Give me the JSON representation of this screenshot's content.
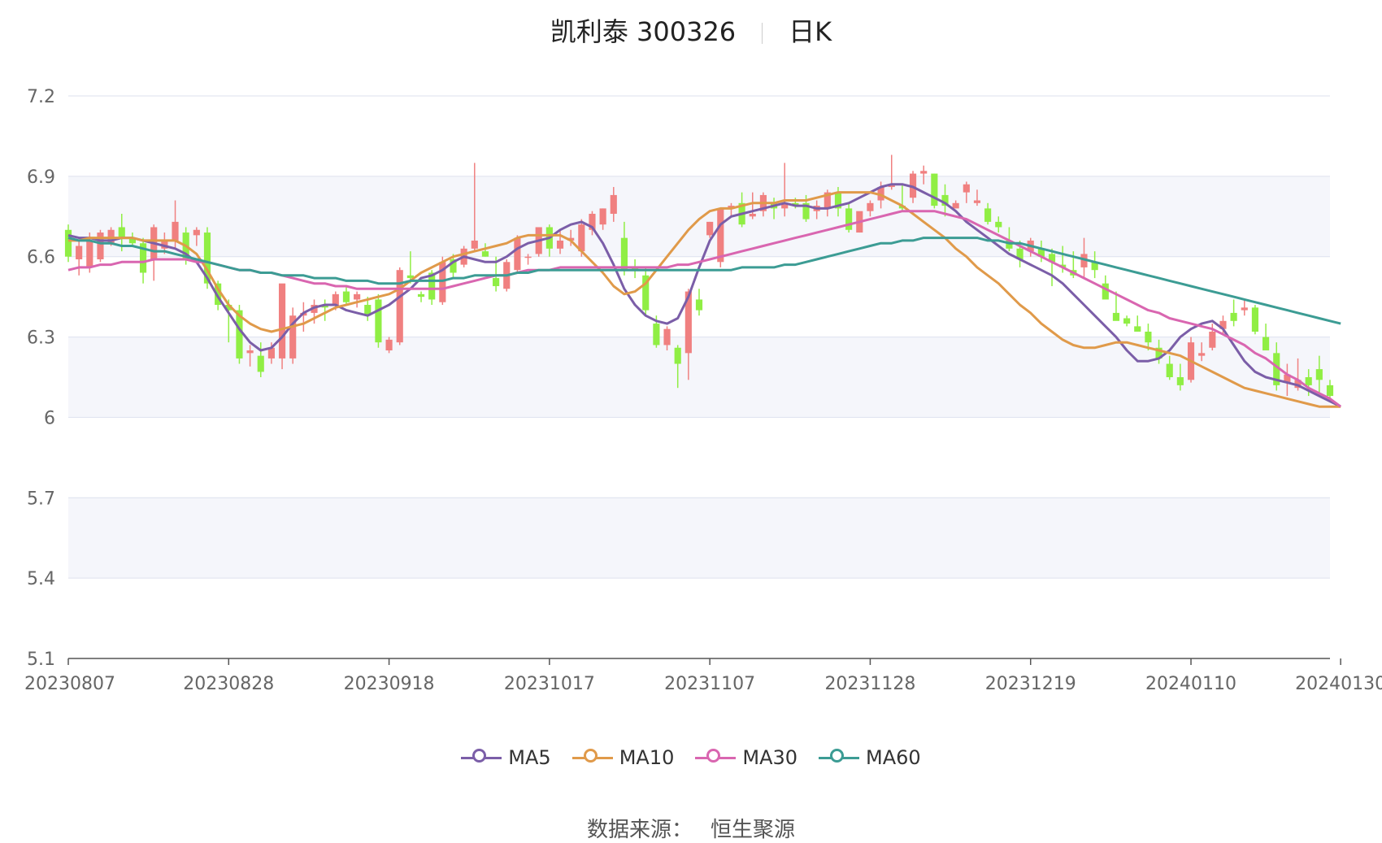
{
  "header": {
    "stock": "凯利泰 300326",
    "period": "日K"
  },
  "source": {
    "label": "数据来源：",
    "value": "恒生聚源"
  },
  "chart_data": {
    "type": "candlestick",
    "title": "凯利泰 300326",
    "period": "日K",
    "ylim": [
      5.1,
      7.2
    ],
    "yticks": [
      "7.2",
      "6.9",
      "6.6",
      "6.3",
      "6",
      "5.7",
      "5.4",
      "5.1"
    ],
    "xticks": [
      {
        "i": 0,
        "label": "20230807"
      },
      {
        "i": 15,
        "label": "20230828"
      },
      {
        "i": 30,
        "label": "20230918"
      },
      {
        "i": 45,
        "label": "20231017"
      },
      {
        "i": 60,
        "label": "20231107"
      },
      {
        "i": 75,
        "label": "20231128"
      },
      {
        "i": 90,
        "label": "20231219"
      },
      {
        "i": 105,
        "label": "20240110"
      },
      {
        "i": 119,
        "label": "20240130"
      }
    ],
    "up_color": "#f08080",
    "down_color": "#90ee44",
    "ohlc": [
      [
        6.7,
        6.72,
        6.58,
        6.6
      ],
      [
        6.59,
        6.66,
        6.53,
        6.64
      ],
      [
        6.56,
        6.69,
        6.54,
        6.66
      ],
      [
        6.59,
        6.7,
        6.58,
        6.69
      ],
      [
        6.65,
        6.71,
        6.64,
        6.7
      ],
      [
        6.71,
        6.76,
        6.62,
        6.67
      ],
      [
        6.67,
        6.69,
        6.64,
        6.65
      ],
      [
        6.65,
        6.67,
        6.5,
        6.54
      ],
      [
        6.59,
        6.72,
        6.51,
        6.71
      ],
      [
        6.63,
        6.69,
        6.61,
        6.66
      ],
      [
        6.66,
        6.81,
        6.63,
        6.73
      ],
      [
        6.69,
        6.71,
        6.57,
        6.59
      ],
      [
        6.68,
        6.71,
        6.64,
        6.7
      ],
      [
        6.69,
        6.71,
        6.48,
        6.5
      ],
      [
        6.5,
        6.51,
        6.4,
        6.42
      ],
      [
        6.42,
        6.44,
        6.28,
        6.4
      ],
      [
        6.4,
        6.42,
        6.2,
        6.22
      ],
      [
        6.24,
        6.27,
        6.19,
        6.25
      ],
      [
        6.23,
        6.28,
        6.15,
        6.17
      ],
      [
        6.22,
        6.28,
        6.2,
        6.26
      ],
      [
        6.22,
        6.26,
        6.18,
        6.5
      ],
      [
        6.22,
        6.41,
        6.2,
        6.38
      ],
      [
        6.38,
        6.43,
        6.32,
        6.39
      ],
      [
        6.39,
        6.44,
        6.35,
        6.42
      ],
      [
        6.42,
        6.44,
        6.36,
        6.41
      ],
      [
        6.42,
        6.47,
        6.4,
        6.46
      ],
      [
        6.47,
        6.49,
        6.42,
        6.43
      ],
      [
        6.44,
        6.47,
        6.41,
        6.46
      ],
      [
        6.42,
        6.45,
        6.36,
        6.38
      ],
      [
        6.44,
        6.46,
        6.26,
        6.28
      ],
      [
        6.25,
        6.3,
        6.24,
        6.29
      ],
      [
        6.28,
        6.56,
        6.27,
        6.55
      ],
      [
        6.53,
        6.62,
        6.5,
        6.52
      ],
      [
        6.46,
        6.47,
        6.43,
        6.45
      ],
      [
        6.54,
        6.55,
        6.42,
        6.44
      ],
      [
        6.43,
        6.6,
        6.42,
        6.58
      ],
      [
        6.59,
        6.61,
        6.52,
        6.54
      ],
      [
        6.57,
        6.64,
        6.56,
        6.63
      ],
      [
        6.63,
        6.95,
        6.62,
        6.66
      ],
      [
        6.62,
        6.65,
        6.6,
        6.6
      ],
      [
        6.52,
        6.6,
        6.47,
        6.49
      ],
      [
        6.48,
        6.59,
        6.47,
        6.58
      ],
      [
        6.55,
        6.68,
        6.54,
        6.67
      ],
      [
        6.6,
        6.61,
        6.57,
        6.6
      ],
      [
        6.61,
        6.7,
        6.6,
        6.71
      ],
      [
        6.71,
        6.72,
        6.6,
        6.63
      ],
      [
        6.63,
        6.7,
        6.61,
        6.66
      ],
      [
        6.66,
        6.7,
        6.64,
        6.67
      ],
      [
        6.62,
        6.74,
        6.6,
        6.72
      ],
      [
        6.7,
        6.77,
        6.68,
        6.76
      ],
      [
        6.72,
        6.78,
        6.7,
        6.78
      ],
      [
        6.76,
        6.86,
        6.73,
        6.83
      ],
      [
        6.67,
        6.73,
        6.53,
        6.55
      ],
      [
        6.56,
        6.59,
        6.52,
        6.55
      ],
      [
        6.53,
        6.56,
        6.38,
        6.4
      ],
      [
        6.35,
        6.38,
        6.26,
        6.27
      ],
      [
        6.27,
        6.34,
        6.25,
        6.33
      ],
      [
        6.26,
        6.27,
        6.11,
        6.2
      ],
      [
        6.24,
        6.48,
        6.14,
        6.47
      ],
      [
        6.44,
        6.48,
        6.38,
        6.4
      ],
      [
        6.68,
        6.73,
        6.67,
        6.73
      ],
      [
        6.58,
        6.78,
        6.56,
        6.78
      ],
      [
        6.78,
        6.8,
        6.75,
        6.79
      ],
      [
        6.8,
        6.84,
        6.71,
        6.72
      ],
      [
        6.75,
        6.84,
        6.74,
        6.76
      ],
      [
        6.77,
        6.84,
        6.75,
        6.83
      ],
      [
        6.8,
        6.82,
        6.74,
        6.78
      ],
      [
        6.78,
        6.95,
        6.75,
        6.8
      ],
      [
        6.8,
        6.82,
        6.78,
        6.79
      ],
      [
        6.8,
        6.83,
        6.73,
        6.74
      ],
      [
        6.77,
        6.81,
        6.74,
        6.79
      ],
      [
        6.78,
        6.85,
        6.75,
        6.84
      ],
      [
        6.84,
        6.86,
        6.75,
        6.78
      ],
      [
        6.78,
        6.8,
        6.69,
        6.7
      ],
      [
        6.69,
        6.7,
        6.69,
        6.77
      ],
      [
        6.77,
        6.81,
        6.75,
        6.8
      ],
      [
        6.81,
        6.88,
        6.78,
        6.86
      ],
      [
        6.86,
        6.98,
        6.85,
        6.87
      ],
      [
        6.79,
        6.87,
        6.77,
        6.78
      ],
      [
        6.82,
        6.92,
        6.8,
        6.91
      ],
      [
        6.91,
        6.94,
        6.87,
        6.92
      ],
      [
        6.91,
        6.91,
        6.78,
        6.79
      ],
      [
        6.83,
        6.87,
        6.75,
        6.79
      ],
      [
        6.78,
        6.81,
        6.78,
        6.8
      ],
      [
        6.84,
        6.88,
        6.8,
        6.87
      ],
      [
        6.8,
        6.85,
        6.79,
        6.81
      ],
      [
        6.78,
        6.8,
        6.72,
        6.73
      ],
      [
        6.73,
        6.75,
        6.69,
        6.71
      ],
      [
        6.66,
        6.71,
        6.62,
        6.63
      ],
      [
        6.63,
        6.66,
        6.56,
        6.59
      ],
      [
        6.62,
        6.67,
        6.6,
        6.66
      ],
      [
        6.63,
        6.66,
        6.58,
        6.6
      ],
      [
        6.61,
        6.63,
        6.49,
        6.58
      ],
      [
        6.57,
        6.64,
        6.54,
        6.56
      ],
      [
        6.55,
        6.62,
        6.52,
        6.53
      ],
      [
        6.56,
        6.67,
        6.52,
        6.61
      ],
      [
        6.58,
        6.62,
        6.52,
        6.55
      ],
      [
        6.5,
        6.53,
        6.48,
        6.44
      ],
      [
        6.39,
        6.47,
        6.37,
        6.36
      ],
      [
        6.37,
        6.38,
        6.34,
        6.35
      ],
      [
        6.34,
        6.38,
        6.32,
        6.32
      ],
      [
        6.32,
        6.35,
        6.25,
        6.28
      ],
      [
        6.26,
        6.29,
        6.2,
        6.22
      ],
      [
        6.2,
        6.23,
        6.14,
        6.15
      ],
      [
        6.15,
        6.2,
        6.1,
        6.12
      ],
      [
        6.14,
        6.3,
        6.13,
        6.28
      ],
      [
        6.23,
        6.28,
        6.21,
        6.24
      ],
      [
        6.26,
        6.35,
        6.25,
        6.32
      ],
      [
        6.33,
        6.38,
        6.31,
        6.36
      ],
      [
        6.39,
        6.44,
        6.34,
        6.36
      ],
      [
        6.4,
        6.44,
        6.38,
        6.41
      ],
      [
        6.41,
        6.42,
        6.31,
        6.32
      ],
      [
        6.3,
        6.35,
        6.26,
        6.25
      ],
      [
        6.24,
        6.28,
        6.1,
        6.12
      ],
      [
        6.13,
        6.2,
        6.08,
        6.16
      ],
      [
        6.11,
        6.22,
        6.1,
        6.14
      ],
      [
        6.15,
        6.18,
        6.08,
        6.12
      ],
      [
        6.18,
        6.23,
        6.08,
        6.14
      ],
      [
        6.12,
        6.14,
        6.07,
        6.08
      ]
    ]
  },
  "moving_averages": [
    {
      "name": "MA5",
      "color": "#7b5ea8",
      "values": [
        6.68,
        6.67,
        6.67,
        6.66,
        6.66,
        6.67,
        6.67,
        6.66,
        6.65,
        6.64,
        6.63,
        6.61,
        6.58,
        6.52,
        6.45,
        6.39,
        6.33,
        6.28,
        6.25,
        6.26,
        6.3,
        6.35,
        6.39,
        6.41,
        6.42,
        6.42,
        6.4,
        6.39,
        6.38,
        6.4,
        6.42,
        6.45,
        6.48,
        6.52,
        6.53,
        6.55,
        6.58,
        6.6,
        6.59,
        6.58,
        6.58,
        6.6,
        6.63,
        6.65,
        6.66,
        6.67,
        6.7,
        6.72,
        6.73,
        6.71,
        6.65,
        6.57,
        6.48,
        6.42,
        6.38,
        6.36,
        6.35,
        6.37,
        6.45,
        6.56,
        6.66,
        6.72,
        6.75,
        6.76,
        6.77,
        6.78,
        6.79,
        6.8,
        6.79,
        6.79,
        6.78,
        6.78,
        6.79,
        6.8,
        6.82,
        6.84,
        6.86,
        6.87,
        6.87,
        6.86,
        6.84,
        6.82,
        6.8,
        6.77,
        6.73,
        6.7,
        6.67,
        6.64,
        6.61,
        6.59,
        6.57,
        6.55,
        6.53,
        6.5,
        6.46,
        6.42,
        6.38,
        6.34,
        6.3,
        6.25,
        6.21,
        6.21,
        6.22,
        6.25,
        6.3,
        6.33,
        6.35,
        6.36,
        6.33,
        6.27,
        6.21,
        6.17,
        6.15,
        6.14,
        6.13,
        6.12,
        6.1,
        6.08,
        6.06,
        6.04
      ]
    },
    {
      "name": "MA10",
      "color": "#e09a4a",
      "values": [
        6.66,
        6.66,
        6.67,
        6.67,
        6.67,
        6.67,
        6.67,
        6.66,
        6.66,
        6.66,
        6.66,
        6.64,
        6.61,
        6.55,
        6.48,
        6.42,
        6.38,
        6.35,
        6.33,
        6.32,
        6.33,
        6.34,
        6.35,
        6.37,
        6.39,
        6.41,
        6.42,
        6.43,
        6.44,
        6.45,
        6.46,
        6.48,
        6.51,
        6.54,
        6.56,
        6.58,
        6.6,
        6.61,
        6.62,
        6.63,
        6.64,
        6.65,
        6.67,
        6.68,
        6.68,
        6.68,
        6.68,
        6.66,
        6.62,
        6.58,
        6.54,
        6.49,
        6.46,
        6.47,
        6.5,
        6.55,
        6.6,
        6.65,
        6.7,
        6.74,
        6.77,
        6.78,
        6.78,
        6.79,
        6.8,
        6.8,
        6.8,
        6.81,
        6.81,
        6.81,
        6.82,
        6.83,
        6.84,
        6.84,
        6.84,
        6.84,
        6.83,
        6.81,
        6.79,
        6.76,
        6.73,
        6.7,
        6.67,
        6.63,
        6.6,
        6.56,
        6.53,
        6.5,
        6.46,
        6.42,
        6.39,
        6.35,
        6.32,
        6.29,
        6.27,
        6.26,
        6.26,
        6.27,
        6.28,
        6.28,
        6.27,
        6.26,
        6.25,
        6.24,
        6.23,
        6.21,
        6.19,
        6.17,
        6.15,
        6.13,
        6.11,
        6.1,
        6.09,
        6.08,
        6.07,
        6.06,
        6.05,
        6.04,
        6.04,
        6.04
      ]
    },
    {
      "name": "MA30",
      "color": "#d966b0",
      "values": [
        6.55,
        6.56,
        6.56,
        6.57,
        6.57,
        6.58,
        6.58,
        6.58,
        6.59,
        6.59,
        6.59,
        6.59,
        6.58,
        6.58,
        6.57,
        6.56,
        6.55,
        6.55,
        6.54,
        6.54,
        6.53,
        6.52,
        6.51,
        6.5,
        6.5,
        6.49,
        6.49,
        6.48,
        6.48,
        6.48,
        6.48,
        6.48,
        6.48,
        6.48,
        6.48,
        6.48,
        6.49,
        6.5,
        6.51,
        6.52,
        6.53,
        6.53,
        6.54,
        6.55,
        6.55,
        6.55,
        6.56,
        6.56,
        6.56,
        6.56,
        6.56,
        6.56,
        6.56,
        6.56,
        6.56,
        6.56,
        6.56,
        6.57,
        6.57,
        6.58,
        6.59,
        6.6,
        6.61,
        6.62,
        6.63,
        6.64,
        6.65,
        6.66,
        6.67,
        6.68,
        6.69,
        6.7,
        6.71,
        6.72,
        6.73,
        6.74,
        6.75,
        6.76,
        6.77,
        6.77,
        6.77,
        6.77,
        6.76,
        6.75,
        6.74,
        6.72,
        6.7,
        6.68,
        6.66,
        6.64,
        6.62,
        6.6,
        6.58,
        6.56,
        6.54,
        6.52,
        6.5,
        6.48,
        6.46,
        6.44,
        6.42,
        6.4,
        6.39,
        6.37,
        6.36,
        6.35,
        6.34,
        6.33,
        6.31,
        6.29,
        6.27,
        6.24,
        6.22,
        6.19,
        6.16,
        6.14,
        6.11,
        6.09,
        6.07,
        6.04
      ]
    },
    {
      "name": "MA60",
      "color": "#3c9c94",
      "values": [
        6.67,
        6.66,
        6.66,
        6.65,
        6.65,
        6.64,
        6.64,
        6.63,
        6.62,
        6.62,
        6.61,
        6.6,
        6.59,
        6.58,
        6.57,
        6.56,
        6.55,
        6.55,
        6.54,
        6.54,
        6.53,
        6.53,
        6.53,
        6.52,
        6.52,
        6.52,
        6.51,
        6.51,
        6.51,
        6.5,
        6.5,
        6.5,
        6.51,
        6.51,
        6.51,
        6.51,
        6.52,
        6.52,
        6.53,
        6.53,
        6.53,
        6.53,
        6.54,
        6.54,
        6.55,
        6.55,
        6.55,
        6.55,
        6.55,
        6.55,
        6.55,
        6.55,
        6.55,
        6.55,
        6.55,
        6.55,
        6.55,
        6.55,
        6.55,
        6.55,
        6.55,
        6.55,
        6.55,
        6.56,
        6.56,
        6.56,
        6.56,
        6.57,
        6.57,
        6.58,
        6.59,
        6.6,
        6.61,
        6.62,
        6.63,
        6.64,
        6.65,
        6.65,
        6.66,
        6.66,
        6.67,
        6.67,
        6.67,
        6.67,
        6.67,
        6.67,
        6.66,
        6.66,
        6.65,
        6.65,
        6.64,
        6.63,
        6.62,
        6.61,
        6.6,
        6.59,
        6.58,
        6.57,
        6.56,
        6.55,
        6.54,
        6.53,
        6.52,
        6.51,
        6.5,
        6.49,
        6.48,
        6.47,
        6.46,
        6.45,
        6.44,
        6.43,
        6.42,
        6.41,
        6.4,
        6.39,
        6.38,
        6.37,
        6.36,
        6.35
      ]
    }
  ]
}
